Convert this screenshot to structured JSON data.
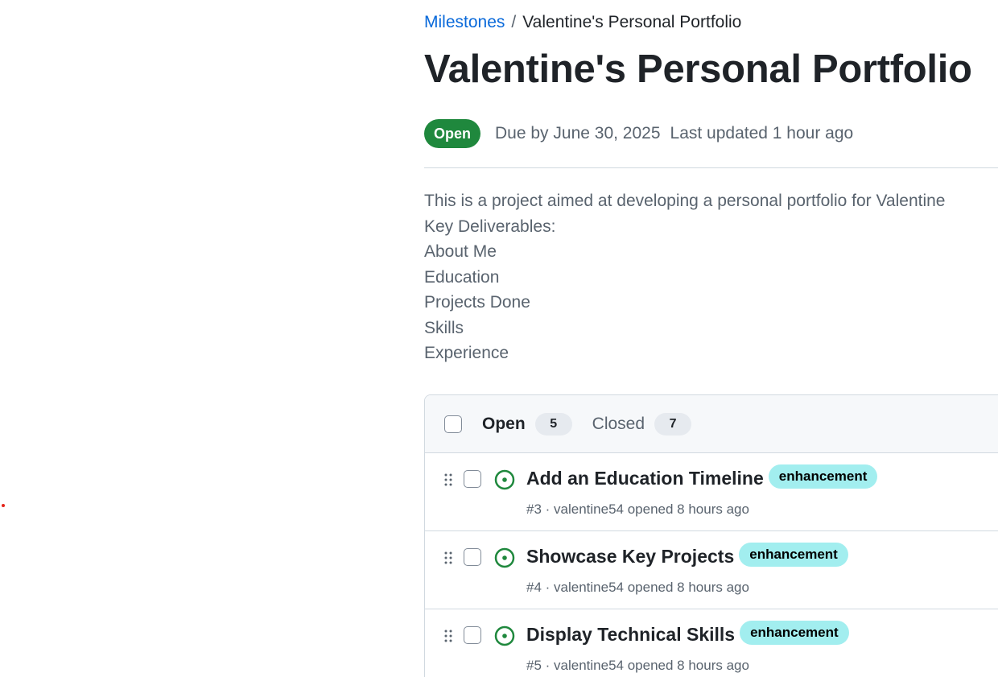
{
  "breadcrumb": {
    "parent": "Milestones",
    "separator": "/",
    "current": "Valentine's Personal Portfolio"
  },
  "milestone": {
    "title": "Valentine's Personal Portfolio",
    "state": "Open",
    "due": "Due by June 30, 2025",
    "updated": "Last updated 1 hour ago",
    "description": [
      "This is a project aimed at developing a personal portfolio for Valentine",
      "Key Deliverables:",
      "About Me",
      "Education",
      "Projects Done",
      "Skills",
      "Experience"
    ]
  },
  "issues_header": {
    "open_label": "Open",
    "open_count": "5",
    "closed_label": "Closed",
    "closed_count": "7"
  },
  "issues": [
    {
      "title": "Add an Education Timeline",
      "label": "enhancement",
      "meta": "#3 · valentine54 opened 8 hours ago"
    },
    {
      "title": "Showcase Key Projects",
      "label": "enhancement",
      "meta": "#4 · valentine54 opened 8 hours ago"
    },
    {
      "title": "Display Technical Skills",
      "label": "enhancement",
      "meta": "#5 · valentine54 opened 8 hours ago"
    }
  ],
  "colors": {
    "link": "#0969da",
    "open_state": "#1f883d",
    "label_enhancement": "#a2eeef",
    "muted_text": "#59636e"
  },
  "icons": {
    "issue_state": "issue-opened-icon",
    "drag": "grabber-icon"
  }
}
